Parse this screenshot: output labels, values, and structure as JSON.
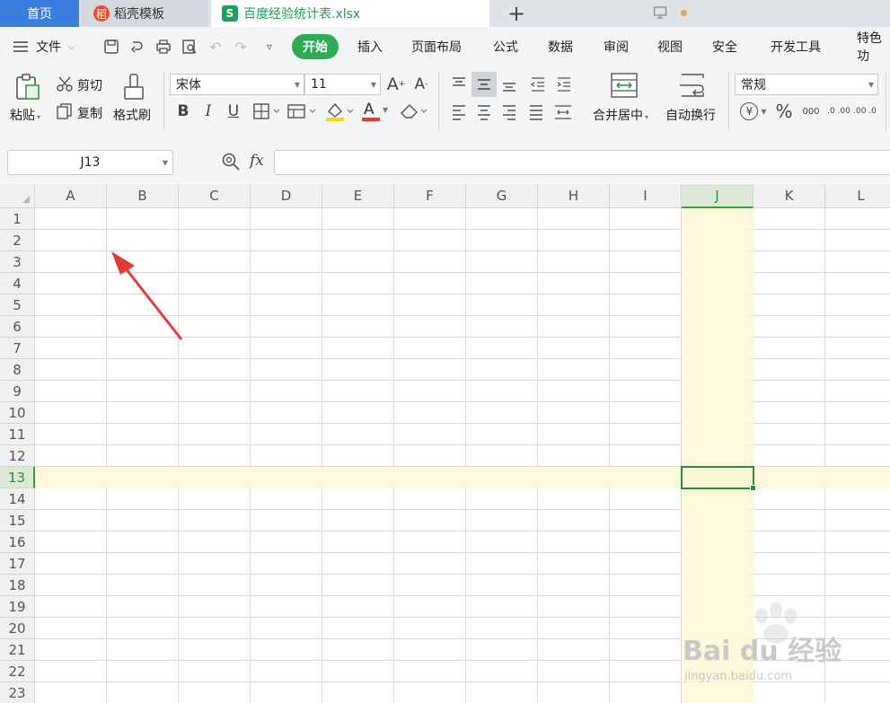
{
  "tabs": {
    "home": "首页",
    "template": "稻壳模板",
    "file": "百度经验统计表.xlsx",
    "template_icon_glyph": "稻",
    "file_icon_glyph": "S"
  },
  "menu": {
    "file_label": "文件",
    "items": [
      "开始",
      "插入",
      "页面布局",
      "公式",
      "数据",
      "审阅",
      "视图",
      "安全",
      "开发工具",
      "特色功"
    ]
  },
  "ribbon": {
    "paste": "粘贴",
    "cut": "剪切",
    "copy": "复制",
    "format_painter": "格式刷",
    "font_name": "宋体",
    "font_size": "11",
    "merge_center": "合并居中",
    "wrap_text": "自动换行",
    "number_format": "常规",
    "bold": "B",
    "italic": "I",
    "underline": "U",
    "font_color_glyph": "A",
    "grow_font": "A",
    "shrink_font": "A",
    "percent": "%",
    "thousands": "000",
    "inc_decimal": ".0 .00",
    "dec_decimal": ".00 .0",
    "currency": "¥"
  },
  "formula_bar": {
    "cell_reference": "J13",
    "fx_label": "fx",
    "formula": ""
  },
  "sheet": {
    "columns": [
      "A",
      "B",
      "C",
      "D",
      "E",
      "F",
      "G",
      "H",
      "I",
      "J",
      "K",
      "L"
    ],
    "rows": [
      "1",
      "2",
      "3",
      "4",
      "5",
      "6",
      "7",
      "8",
      "9",
      "10",
      "11",
      "12",
      "13",
      "14",
      "15",
      "16",
      "17",
      "18",
      "19",
      "20",
      "21",
      "22",
      "23"
    ],
    "active_column": "J",
    "active_row": "13"
  },
  "watermark": {
    "brand": "Bai  du 经验",
    "url": "jingyan.baidu.com"
  },
  "colors": {
    "accent_green": "#2dab56",
    "tab_blue": "#3a7fe0",
    "highlight": "#faf8d2",
    "arrow_red": "#e53935"
  }
}
